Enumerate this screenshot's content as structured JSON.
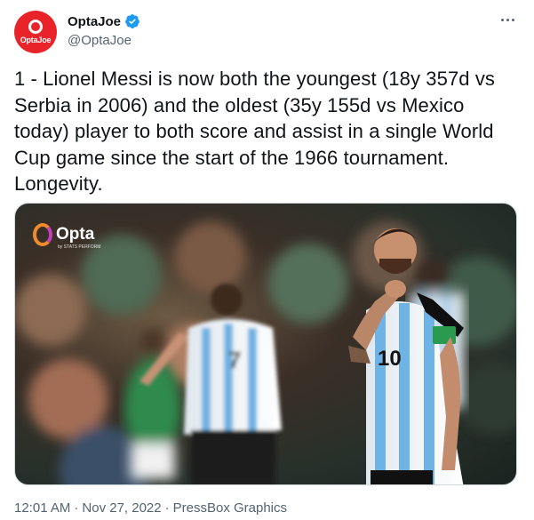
{
  "author": {
    "display_name": "OptaJoe",
    "handle": "@OptaJoe",
    "avatar_text": "OptaJoe",
    "verified_icon": "verified-badge-icon"
  },
  "tweet": {
    "text": "1 - Lionel Messi is now both the youngest (18y 357d vs Serbia in 2006) and the oldest (35y 155d vs Mexico today) player to both score and assist in a single World Cup game since the start of the 1966 tournament.\nLongevity."
  },
  "media": {
    "watermark": "Opta",
    "watermark_sub": "by STATS PERFORM",
    "shirt_numbers": [
      "7",
      "10"
    ]
  },
  "meta": {
    "time": "12:01 AM",
    "separator": "·",
    "date": "Nov 27, 2022",
    "source": "PressBox Graphics"
  },
  "colors": {
    "accent": "#1d9bf0",
    "brand": "#e8232a",
    "text": "#0f1419",
    "muted": "#536471"
  }
}
